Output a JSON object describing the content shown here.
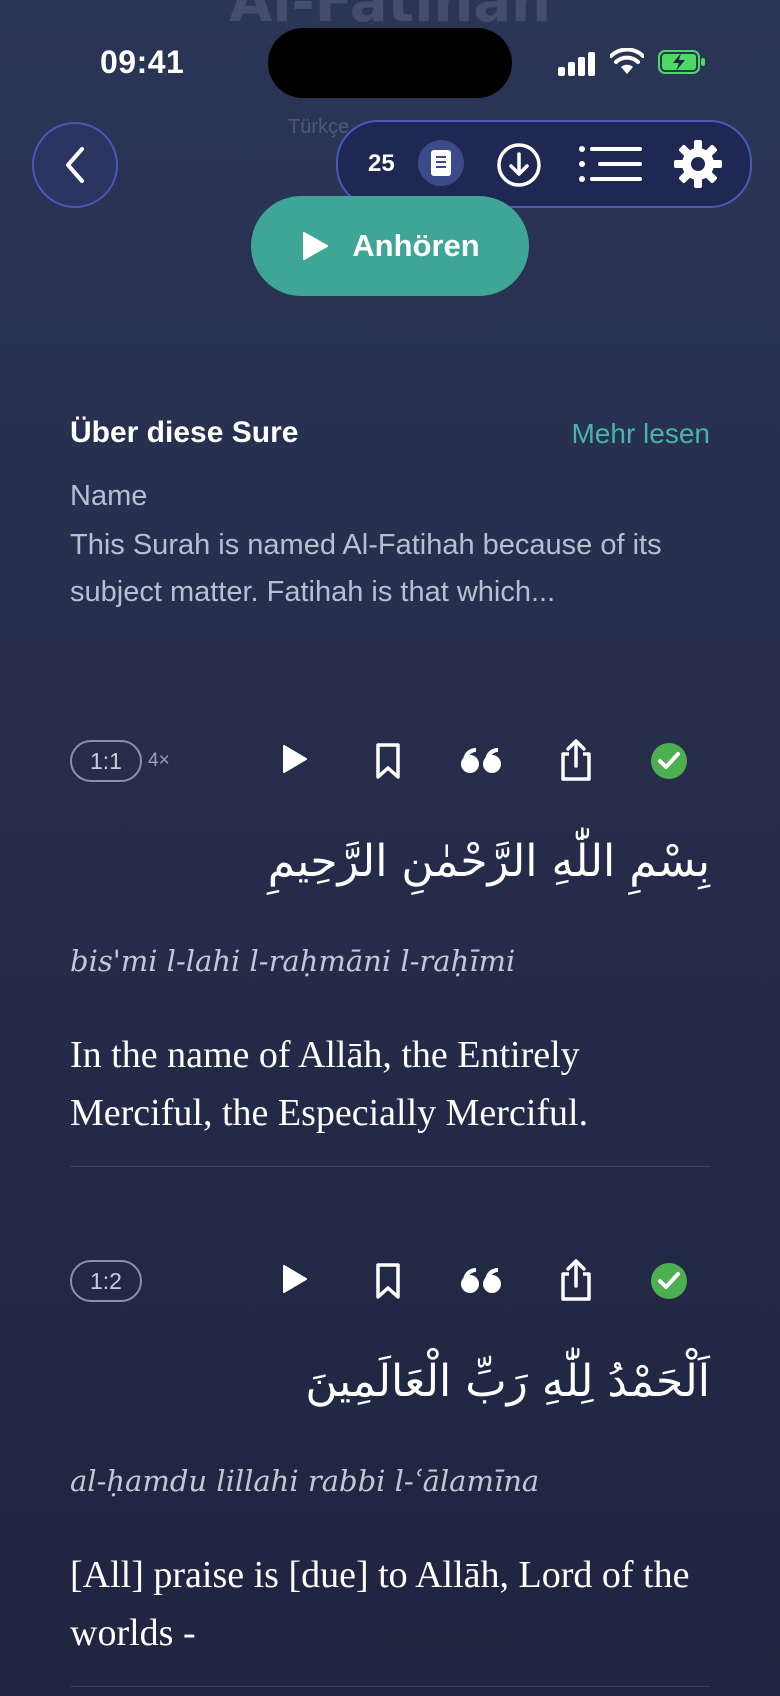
{
  "header": {
    "ghost_title": "Al-Fatihah",
    "hidden_language": "Türkçe",
    "page_number": "25",
    "listen_label": "Anhören"
  },
  "status": {
    "time": "09:41"
  },
  "about": {
    "title": "Über diese Sure",
    "more_label": "Mehr lesen",
    "name_label": "Name",
    "summary": "This Surah is named Al-Fatihah because of its subject matter. Fatihah is that which..."
  },
  "verses": [
    {
      "ref": "1:1",
      "repeat": "4×",
      "arabic": "بِسْمِ اللّٰهِ الرَّحْمٰنِ الرَّحِيمِ",
      "transliteration": "bis'mi l-lahi l-raḥmāni l-raḥīmi",
      "translation": "In the name of Allāh, the Entirely Merciful, the Especially Merciful."
    },
    {
      "ref": "1:2",
      "repeat": "",
      "arabic": "اَلْحَمْدُ لِلّٰهِ رَبِّ الْعَالَمِينَ",
      "transliteration": "al-ḥamdu lillahi rabbi l-ʿālamīna",
      "translation": "[All] praise is [due] to Allāh, Lord of the worlds -"
    }
  ],
  "colors": {
    "accent": "#3fa697",
    "link": "#49b5a6",
    "check": "#4caf50",
    "border": "#4a58b8"
  }
}
